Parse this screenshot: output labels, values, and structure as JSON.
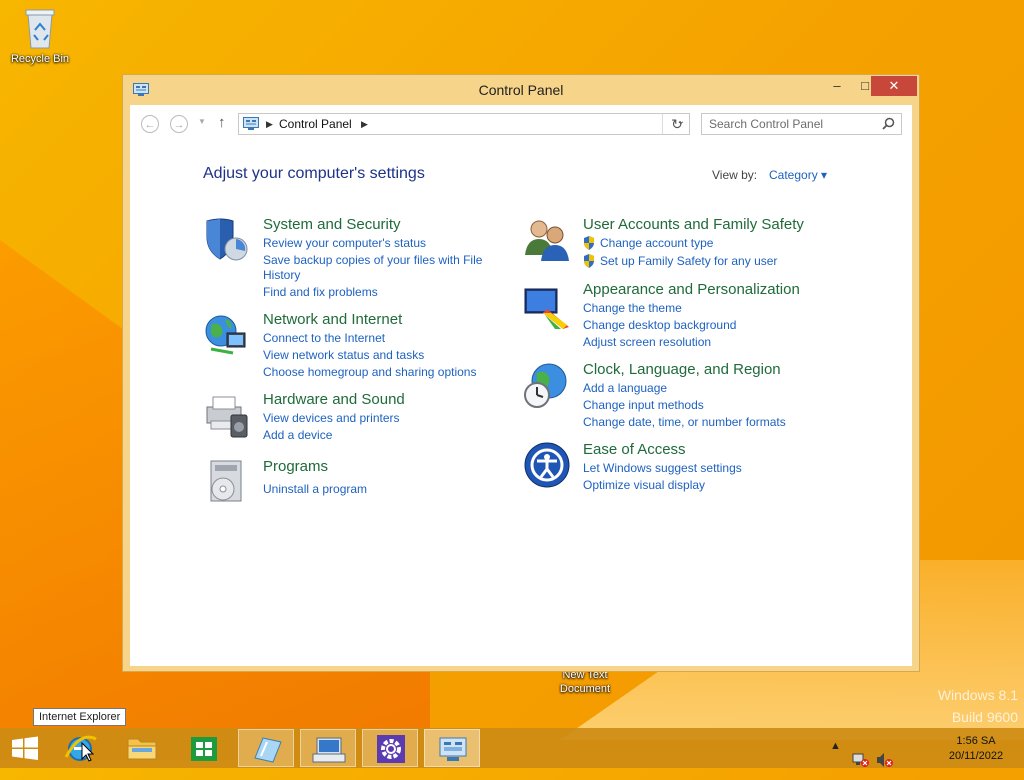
{
  "desktop": {
    "recycle_bin_label": "Recycle Bin",
    "new_text_doc_label_1": "New Text",
    "new_text_doc_label_2": "Document",
    "watermark_line1": "Windows 8.1",
    "watermark_line2": "Build 9600"
  },
  "window": {
    "title": "Control Panel",
    "controls": {
      "minimize": "–",
      "maximize": "□",
      "close": "✕"
    }
  },
  "address_bar": {
    "path_label": "Control Panel",
    "search_placeholder": "Search Control Panel"
  },
  "main": {
    "heading": "Adjust your computer's settings",
    "view_by_label": "View by:",
    "view_by_value": "Category ▾"
  },
  "categories": {
    "system_security": {
      "title": "System and Security",
      "links": [
        "Review your computer's status",
        "Save backup copies of your files with File",
        "History",
        "Find and fix problems"
      ]
    },
    "network_internet": {
      "title": "Network and Internet",
      "links": [
        "Connect to the Internet",
        "View network status and tasks",
        "Choose homegroup and sharing options"
      ]
    },
    "hardware_sound": {
      "title": "Hardware and Sound",
      "links": [
        "View devices and printers",
        "Add a device"
      ]
    },
    "programs": {
      "title": "Programs",
      "links": [
        "Uninstall a program"
      ]
    },
    "user_accounts": {
      "title": "User Accounts and Family Safety",
      "links": [
        "Change account type",
        "Set up Family Safety for any user"
      ]
    },
    "appearance": {
      "title": "Appearance and Personalization",
      "links": [
        "Change the theme",
        "Change desktop background",
        "Adjust screen resolution"
      ]
    },
    "clock_region": {
      "title": "Clock, Language, and Region",
      "links": [
        "Add a language",
        "Change input methods",
        "Change date, time, or number formats"
      ]
    },
    "ease_access": {
      "title": "Ease of Access",
      "links": [
        "Let Windows suggest settings",
        "Optimize visual display"
      ]
    }
  },
  "taskbar": {
    "tooltip": "Internet Explorer",
    "time": "1:56 SA",
    "date": "20/11/2022"
  },
  "colors": {
    "link": "#1e62c0",
    "category_title": "#1f6b3a",
    "heading": "#1e3287",
    "close_button": "#c7473a"
  }
}
